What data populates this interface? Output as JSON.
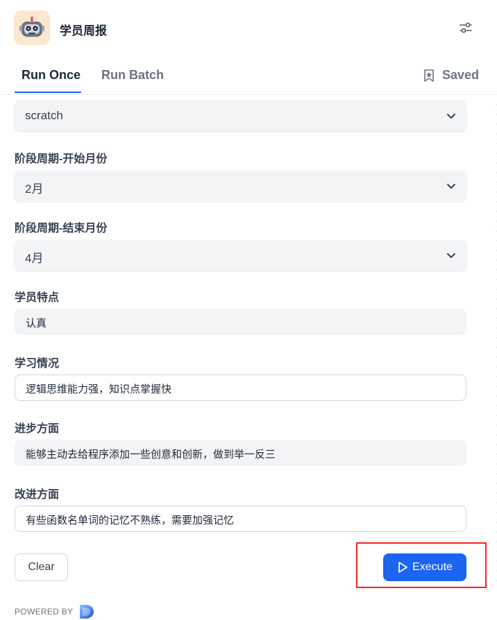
{
  "app": {
    "title": "学员周报",
    "icon": "robot-icon",
    "icon_bg": "#fde7d0"
  },
  "tabs": [
    {
      "label": "Run Once",
      "active": true
    },
    {
      "label": "Run Batch",
      "active": false
    }
  ],
  "saved_label": "Saved",
  "fields": {
    "course": {
      "value": "scratch"
    },
    "start_month": {
      "label": "阶段周期-开始月份",
      "value": "2月"
    },
    "end_month": {
      "label": "阶段周期-结束月份",
      "value": "4月"
    },
    "traits": {
      "label": "学员特点",
      "value": "认真"
    },
    "learning": {
      "label": "学习情况",
      "value": "逻辑思维能力强，知识点掌握快"
    },
    "progress": {
      "label": "进步方面",
      "value": "能够主动去给程序添加一些创意和创新，做到举一反三"
    },
    "improve": {
      "label": "改进方面",
      "value": "有些函数名单词的记忆不熟练，需要加强记忆"
    }
  },
  "buttons": {
    "clear": "Clear",
    "execute": "Execute"
  },
  "footer": {
    "powered_by": "POWERED BY"
  },
  "colors": {
    "accent": "#1c64f2",
    "highlight": "#ff1f1f",
    "input_bg": "#f3f4f6"
  }
}
